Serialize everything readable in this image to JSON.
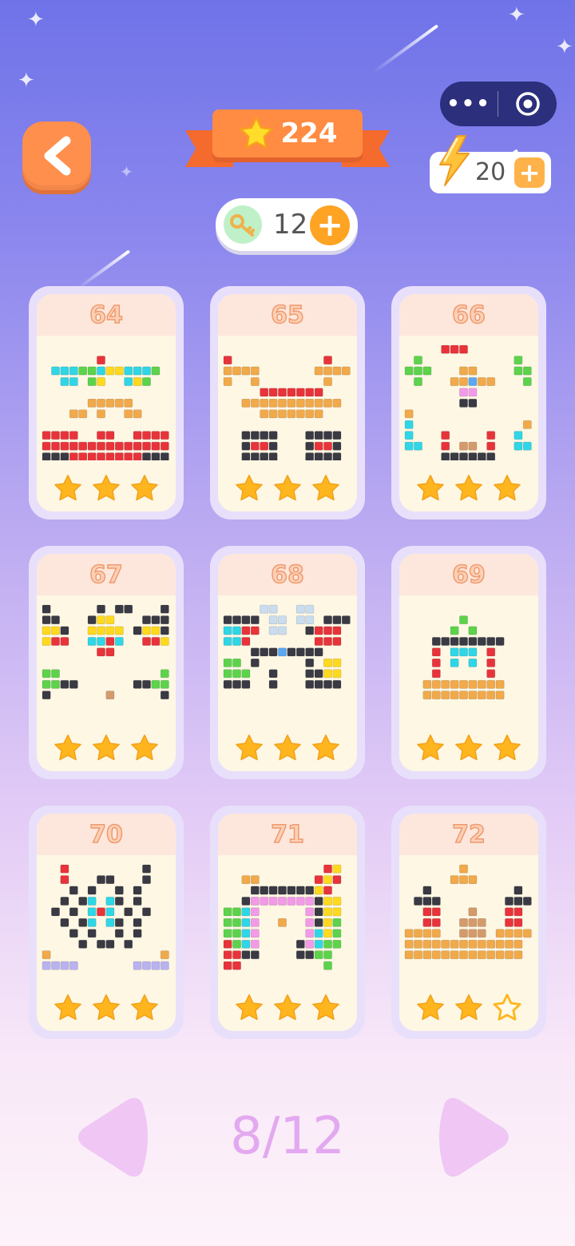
{
  "header": {
    "stars_total": "224",
    "energy": "20",
    "keys": "12"
  },
  "levels": [
    {
      "number": "64",
      "stars": 3
    },
    {
      "number": "65",
      "stars": 3
    },
    {
      "number": "66",
      "stars": 3
    },
    {
      "number": "67",
      "stars": 3
    },
    {
      "number": "68",
      "stars": 3
    },
    {
      "number": "69",
      "stars": 3
    },
    {
      "number": "70",
      "stars": 3
    },
    {
      "number": "71",
      "stars": 3
    },
    {
      "number": "72",
      "stars": 2
    }
  ],
  "pagination": {
    "page_label": "8/12"
  },
  "colors": {
    "accent_orange": "#ff8f4d",
    "star_gold": "#ffb61e",
    "capsule_navy": "#2b2f7c",
    "page_label": "#e3a9f0"
  }
}
